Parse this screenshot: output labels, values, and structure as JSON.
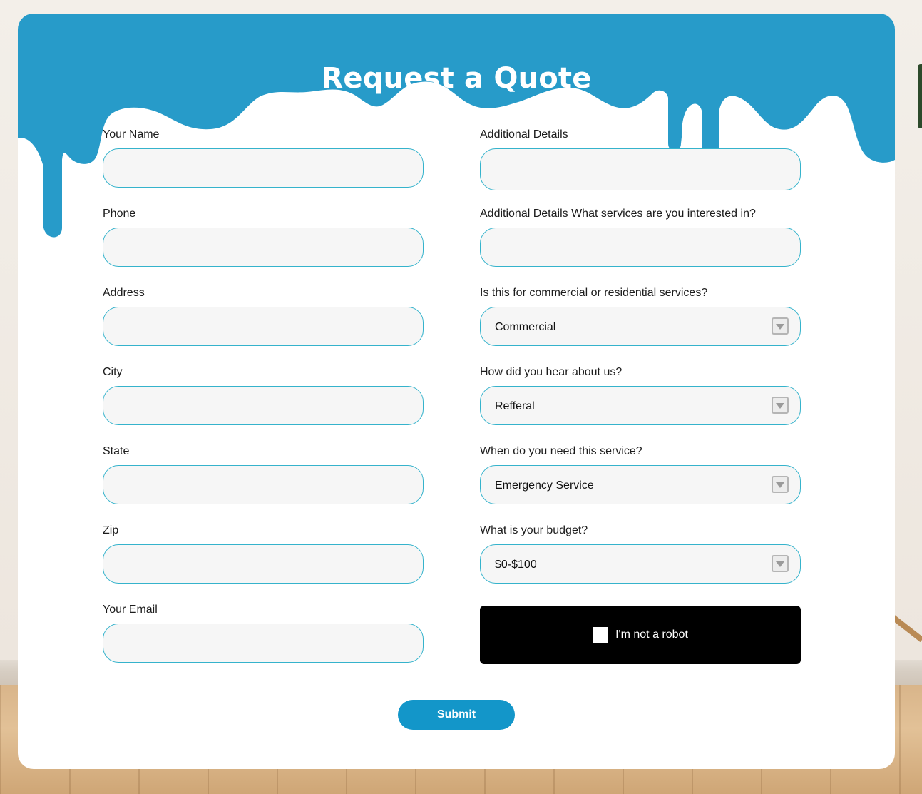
{
  "colors": {
    "accent": "#279bc9",
    "field_border": "#35b3cc",
    "field_bg": "#f6f6f6",
    "submit_bg": "#1396c9",
    "captcha_bg": "#000000"
  },
  "form": {
    "title": "Request a Quote",
    "left_fields": [
      {
        "label": "Your Name",
        "value": ""
      },
      {
        "label": "Phone",
        "value": ""
      },
      {
        "label": "Address",
        "value": ""
      },
      {
        "label": "City",
        "value": ""
      },
      {
        "label": "State",
        "value": ""
      },
      {
        "label": "Zip",
        "value": ""
      },
      {
        "label": "Your Email",
        "value": ""
      }
    ],
    "right_fields": [
      {
        "label": "Additional Details",
        "value": ""
      },
      {
        "label": "Additional Details What services are you interested in?",
        "value": ""
      }
    ],
    "selects": [
      {
        "label": "Is this for commercial or residential services?",
        "value": "Commercial",
        "icon": "dropdown-arrow-icon"
      },
      {
        "label": "How did you hear about us?",
        "value": "Refferal",
        "icon": "dropdown-arrow-icon"
      },
      {
        "label": "When do you need this service?",
        "value": "Emergency Service",
        "icon": "dropdown-arrow-icon"
      },
      {
        "label": "What is your budget?",
        "value": "$0-$100",
        "icon": "dropdown-arrow-icon"
      }
    ],
    "captcha_label": "I'm not a robot",
    "submit_label": "Submit"
  }
}
